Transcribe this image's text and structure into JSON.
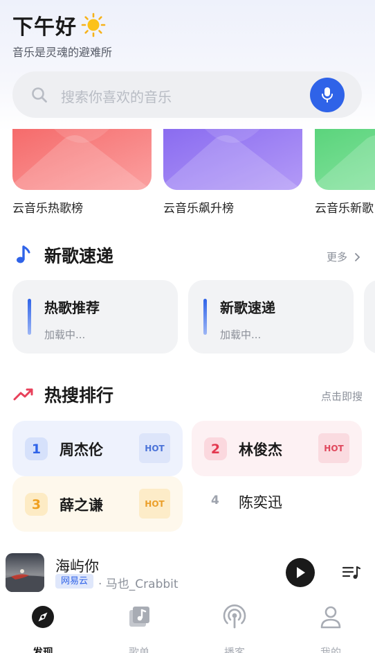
{
  "header": {
    "greeting": "下午好",
    "subtitle": "音乐是灵魂的避难所"
  },
  "search": {
    "placeholder": "搜索你喜欢的音乐",
    "accent": "#2f63e8"
  },
  "charts": [
    {
      "label": "云音乐热歌榜",
      "color": "#f87e7e"
    },
    {
      "label": "云音乐飙升榜",
      "color": "#9b7cf3"
    },
    {
      "label": "云音乐新歌",
      "color": "#6fd98c"
    }
  ],
  "new_songs": {
    "title": "新歌速递",
    "more": "更多",
    "cards": [
      {
        "title": "热歌推荐",
        "status": "加载中..."
      },
      {
        "title": "新歌速递",
        "status": "加载中..."
      }
    ]
  },
  "hot_search": {
    "title": "热搜排行",
    "action": "点击即搜",
    "items": [
      {
        "rank": "1",
        "name": "周杰伦",
        "badge": "HOT",
        "bg": "#eef2fd",
        "rank_bg": "#d6e1fb",
        "rank_color": "#2f63e8",
        "badge_bg": "#dde5fa",
        "badge_color": "#4a72d8"
      },
      {
        "rank": "2",
        "name": "林俊杰",
        "badge": "HOT",
        "bg": "#fdf1f3",
        "rank_bg": "#fbd8de",
        "rank_color": "#e3384f",
        "badge_bg": "#fadbe0",
        "badge_color": "#e0475c"
      },
      {
        "rank": "3",
        "name": "薛之谦",
        "badge": "HOT",
        "bg": "#fef8ec",
        "rank_bg": "#fdebc4",
        "rank_color": "#f0a020",
        "badge_bg": "#fdecc8",
        "badge_color": "#eb9f2a"
      },
      {
        "rank": "4",
        "name": "陈奕迅",
        "badge": ""
      }
    ]
  },
  "player": {
    "title": "海屿你",
    "source": "网易云",
    "artist": "· 马也_Crabbit"
  },
  "tabs": [
    {
      "label": "发现",
      "icon": "compass-icon",
      "active": true
    },
    {
      "label": "歌单",
      "icon": "playlist-icon",
      "active": false
    },
    {
      "label": "播客",
      "icon": "podcast-icon",
      "active": false
    },
    {
      "label": "我的",
      "icon": "user-icon",
      "active": false
    }
  ]
}
